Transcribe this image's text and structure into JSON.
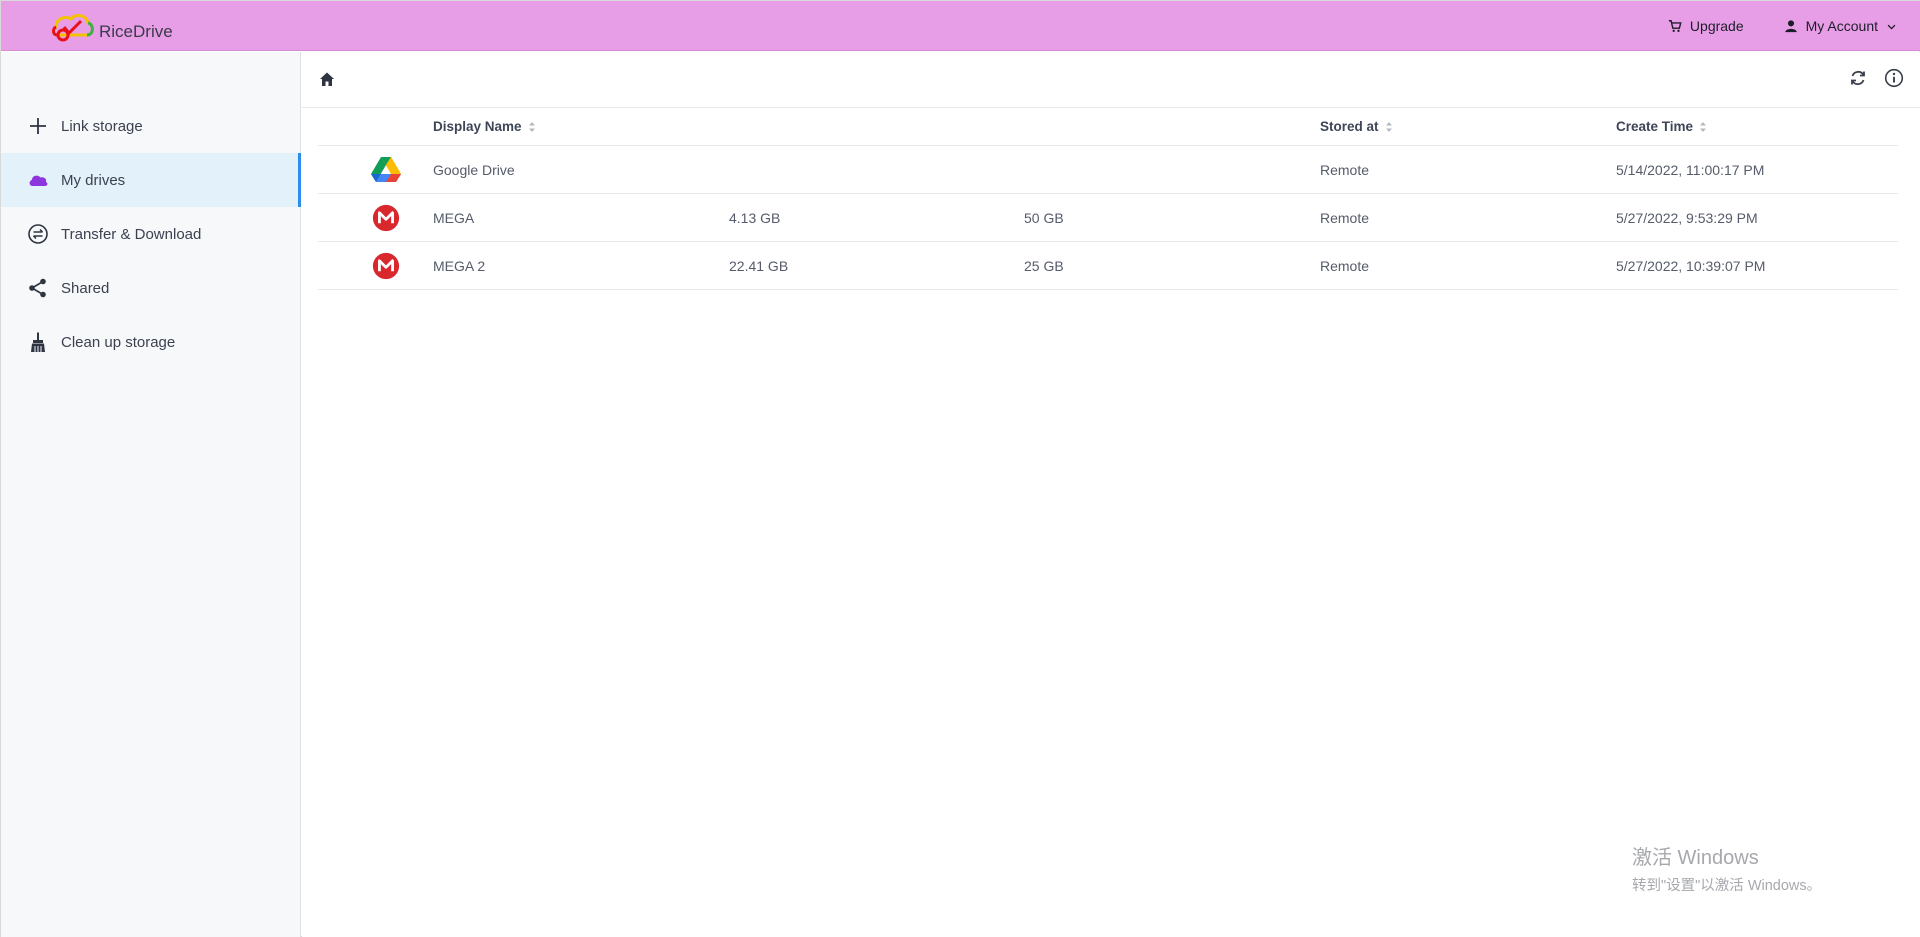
{
  "app": {
    "name": "RiceDrive",
    "header_color": "#e89ee6"
  },
  "header": {
    "upgrade_label": "Upgrade",
    "account_label": "My Account"
  },
  "sidebar": {
    "items": [
      {
        "label": "Link storage",
        "icon": "plus-icon"
      },
      {
        "label": "My drives",
        "icon": "cloud-icon",
        "active": true
      },
      {
        "label": "Transfer & Download",
        "icon": "transfer-icon"
      },
      {
        "label": "Shared",
        "icon": "share-icon"
      },
      {
        "label": "Clean up storage",
        "icon": "broom-icon"
      }
    ]
  },
  "table": {
    "columns": {
      "name": "Display Name",
      "stored": "Stored at",
      "time": "Create Time"
    },
    "rows": [
      {
        "icon": "google-drive-icon",
        "name": "Google Drive",
        "used": "",
        "total": "",
        "stored": "Remote",
        "time": "5/14/2022, 11:00:17 PM"
      },
      {
        "icon": "mega-icon",
        "name": "MEGA",
        "used": "4.13 GB",
        "total": "50 GB",
        "stored": "Remote",
        "time": "5/27/2022, 9:53:29 PM"
      },
      {
        "icon": "mega-icon",
        "name": "MEGA 2",
        "used": "22.41 GB",
        "total": "25 GB",
        "stored": "Remote",
        "time": "5/27/2022, 10:39:07 PM"
      }
    ]
  },
  "watermark": {
    "title": "激活 Windows",
    "subtitle": "转到\"设置\"以激活 Windows。"
  }
}
